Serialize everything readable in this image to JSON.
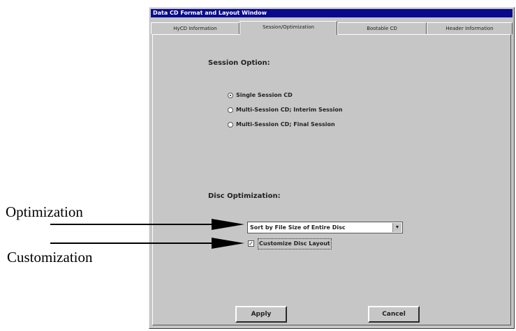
{
  "window": {
    "title": "Data CD Format and Layout Window",
    "tabs": [
      {
        "label": "HyCD Information"
      },
      {
        "label": "Session/Optimization"
      },
      {
        "label": "Bootable CD"
      },
      {
        "label": "Header Information"
      }
    ],
    "active_tab": "Session/Optimization"
  },
  "session": {
    "title": "Session Option:",
    "options": [
      {
        "label": "Single Session CD",
        "checked": true
      },
      {
        "label": "Multi-Session CD; Interim Session",
        "checked": false
      },
      {
        "label": "Multi-Session CD; Final Session",
        "checked": false
      }
    ]
  },
  "optimization": {
    "title": "Disc Optimization:",
    "selected": "Sort by File Size of Entire Disc",
    "customize_label": "Customize Disc Layout",
    "customize_checked": true
  },
  "buttons": {
    "apply": "Apply",
    "cancel": "Cancel"
  },
  "callouts": {
    "optimization": "Optimization",
    "customization": "Customization"
  },
  "icons": {
    "check": "✓",
    "dropdown": "▼"
  }
}
